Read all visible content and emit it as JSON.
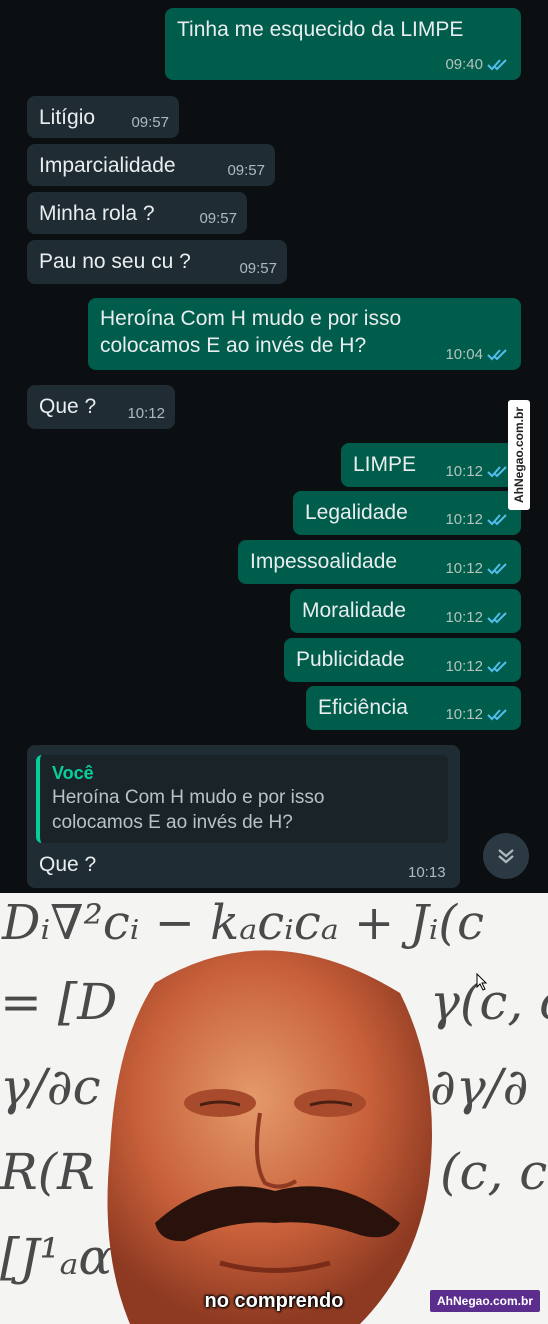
{
  "chat": {
    "messages": [
      {
        "dir": "out",
        "text": "Tinha me esquecido da LIMPE",
        "time": "09:40"
      },
      {
        "dir": "in",
        "text": "Litígio",
        "time": "09:57"
      },
      {
        "dir": "in",
        "text": "Imparcialidade",
        "time": "09:57"
      },
      {
        "dir": "in",
        "text": "Minha rola ?",
        "time": "09:57"
      },
      {
        "dir": "in",
        "text": "Pau no seu cu ?",
        "time": "09:57"
      },
      {
        "dir": "out",
        "text_line1": "Heroína Com H mudo e por isso",
        "text_line2": "colocamos E ao invés de H?",
        "time": "10:04"
      },
      {
        "dir": "in",
        "text": "Que ?",
        "time": "10:12"
      },
      {
        "dir": "out",
        "text": "LIMPE",
        "time": "10:12"
      },
      {
        "dir": "out",
        "text": "Legalidade",
        "time": "10:12"
      },
      {
        "dir": "out",
        "text": "Impessoalidade",
        "time": "10:12"
      },
      {
        "dir": "out",
        "text": "Moralidade",
        "time": "10:12"
      },
      {
        "dir": "out",
        "text": "Publicidade",
        "time": "10:12"
      },
      {
        "dir": "out",
        "text": "Eficiência",
        "time": "10:12"
      }
    ],
    "reply": {
      "quoted_author": "Você",
      "quoted_line1": "Heroína Com H mudo e por isso",
      "quoted_line2": "colocamos E ao invés de H?",
      "text": "Que ?",
      "time": "10:13"
    },
    "watermark": "AhNegao.com.br",
    "colors": {
      "background": "#0b0f12",
      "incoming": "#1f2c33",
      "outgoing": "#005c4b",
      "read_tick": "#53bdeb",
      "quote_accent": "#06cf9c"
    }
  },
  "meme": {
    "equations": [
      "Dᵢ∇²cᵢ − kₐcᵢcₐ + Jᵢ(c",
      "= [D",
      "γ(c, c",
      "γ/∂c",
      "∂γ/∂",
      "R(R",
      "(c, c",
      "[J¹ₐα("
    ],
    "caption": "no comprendo",
    "brand": "AhNegao.com.br"
  }
}
